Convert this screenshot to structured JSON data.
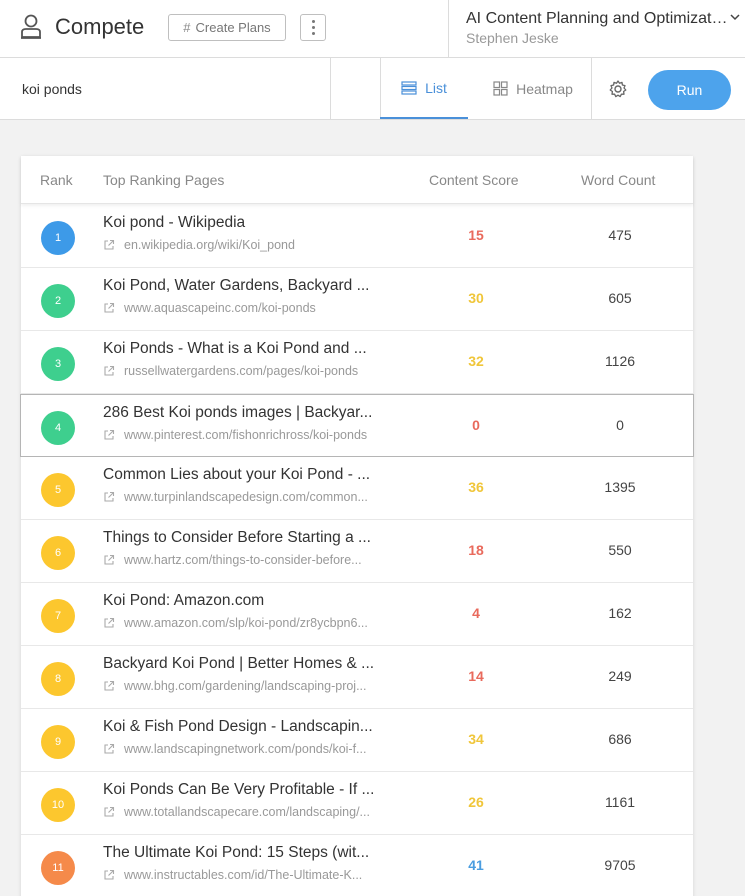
{
  "app": {
    "title": "Compete",
    "create_plans": "Create Plans"
  },
  "project": {
    "title": "AI Content Planning and Optimization",
    "owner": "Stephen Jeske"
  },
  "search": {
    "query": "koi ponds"
  },
  "tabs": {
    "list": "List",
    "heatmap": "Heatmap"
  },
  "run_label": "Run",
  "table": {
    "headers": {
      "rank": "Rank",
      "pages": "Top Ranking Pages",
      "score": "Content Score",
      "words": "Word Count"
    },
    "rows": [
      {
        "rank": "1",
        "title": "Koi pond - Wikipedia",
        "url": "en.wikipedia.org/wiki/Koi_pond",
        "score": "15",
        "words": "475",
        "badge_color": "#3d9ae8",
        "score_color": "#e96a5c"
      },
      {
        "rank": "2",
        "title": "Koi Pond, Water Gardens, Backyard ...",
        "url": "www.aquascapeinc.com/koi-ponds",
        "score": "30",
        "words": "605",
        "badge_color": "#3ecf8e",
        "score_color": "#f0c63a"
      },
      {
        "rank": "3",
        "title": "Koi Ponds - What is a Koi Pond and ...",
        "url": "russellwatergardens.com/pages/koi-ponds",
        "score": "32",
        "words": "1126",
        "badge_color": "#3ecf8e",
        "score_color": "#f0c63a"
      },
      {
        "rank": "4",
        "title": "286 Best Koi ponds images | Backyar...",
        "url": "www.pinterest.com/fishonrichross/koi-ponds",
        "score": "0",
        "words": "0",
        "badge_color": "#3ecf8e",
        "score_color": "#e96a5c"
      },
      {
        "rank": "5",
        "title": "Common Lies about your Koi Pond - ...",
        "url": "www.turpinlandscapedesign.com/common...",
        "score": "36",
        "words": "1395",
        "badge_color": "#fcc72e",
        "score_color": "#f0c63a"
      },
      {
        "rank": "6",
        "title": "Things to Consider Before Starting a ...",
        "url": "www.hartz.com/things-to-consider-before...",
        "score": "18",
        "words": "550",
        "badge_color": "#fcc72e",
        "score_color": "#e96a5c"
      },
      {
        "rank": "7",
        "title": "Koi Pond: Amazon.com",
        "url": "www.amazon.com/slp/koi-pond/zr8ycbpn6...",
        "score": "4",
        "words": "162",
        "badge_color": "#fcc72e",
        "score_color": "#e96a5c"
      },
      {
        "rank": "8",
        "title": "Backyard Koi Pond | Better Homes & ...",
        "url": "www.bhg.com/gardening/landscaping-proj...",
        "score": "14",
        "words": "249",
        "badge_color": "#fcc72e",
        "score_color": "#e96a5c"
      },
      {
        "rank": "9",
        "title": "Koi & Fish Pond Design - Landscapin...",
        "url": "www.landscapingnetwork.com/ponds/koi-f...",
        "score": "34",
        "words": "686",
        "badge_color": "#fcc72e",
        "score_color": "#f0c63a"
      },
      {
        "rank": "10",
        "title": "Koi Ponds Can Be Very Profitable - If ...",
        "url": "www.totallandscapecare.com/landscaping/...",
        "score": "26",
        "words": "1161",
        "badge_color": "#fcc72e",
        "score_color": "#f0c63a"
      },
      {
        "rank": "11",
        "title": "The Ultimate Koi Pond: 15 Steps (wit...",
        "url": "www.instructables.com/id/The-Ultimate-K...",
        "score": "41",
        "words": "9705",
        "badge_color": "#f58a4a",
        "score_color": "#4a9de0"
      }
    ]
  }
}
